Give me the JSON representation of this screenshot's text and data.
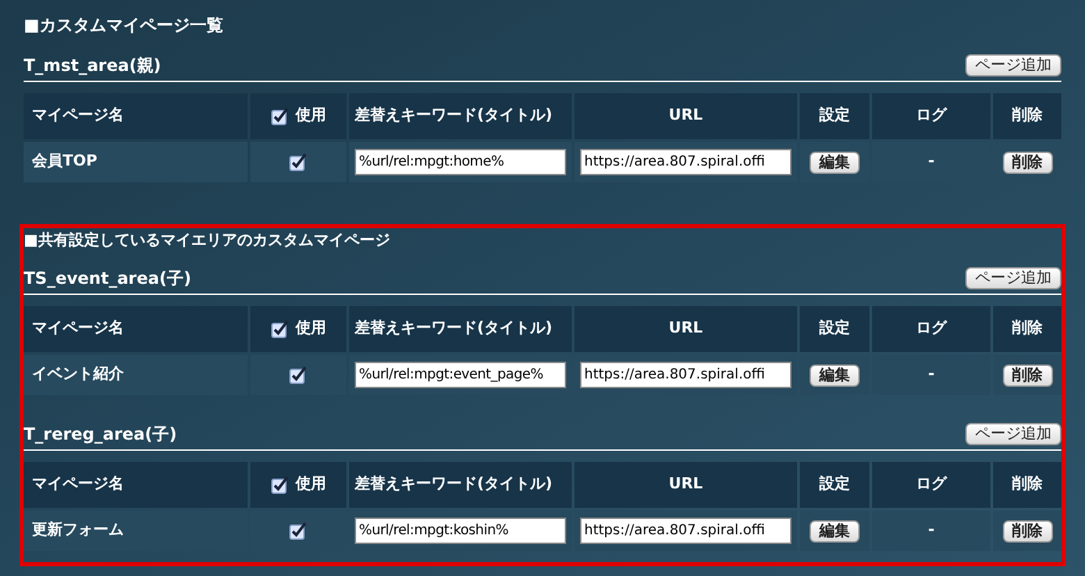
{
  "title": "■カスタムマイページ一覧",
  "groups": [
    {
      "area": "T_mst_area(親)",
      "add_button": "ページ追加",
      "columns": {
        "name": "マイページ名",
        "use": "使用",
        "use_checked": true,
        "keyword": "差替えキーワード(タイトル)",
        "url": "URL",
        "settings": "設定",
        "log": "ログ",
        "delete": "削除"
      },
      "rows": [
        {
          "name": "会員TOP",
          "enabled": true,
          "keyword": "%url/rel:mpgt:home%",
          "url": "https://area.807.spiral.offi",
          "edit_button": "編集",
          "log": "-",
          "delete_button": "削除"
        }
      ]
    }
  ],
  "shared": {
    "title": "■共有設定しているマイエリアのカスタムマイページ",
    "highlighted": true,
    "groups": [
      {
        "area": "TS_event_area(子)",
        "add_button": "ページ追加",
        "columns": {
          "name": "マイページ名",
          "use": "使用",
          "use_checked": true,
          "keyword": "差替えキーワード(タイトル)",
          "url": "URL",
          "settings": "設定",
          "log": "ログ",
          "delete": "削除"
        },
        "rows": [
          {
            "name": "イベント紹介",
            "enabled": true,
            "keyword": "%url/rel:mpgt:event_page%",
            "url": "https://area.807.spiral.offi",
            "edit_button": "編集",
            "log": "-",
            "delete_button": "削除"
          }
        ]
      },
      {
        "area": "T_rereg_area(子)",
        "add_button": "ページ追加",
        "columns": {
          "name": "マイページ名",
          "use": "使用",
          "use_checked": true,
          "keyword": "差替えキーワード(タイトル)",
          "url": "URL",
          "settings": "設定",
          "log": "ログ",
          "delete": "削除"
        },
        "rows": [
          {
            "name": "更新フォーム",
            "enabled": true,
            "keyword": "%url/rel:mpgt:koshin%",
            "url": "https://area.807.spiral.offi",
            "edit_button": "編集",
            "log": "-",
            "delete_button": "削除"
          }
        ]
      }
    ]
  }
}
